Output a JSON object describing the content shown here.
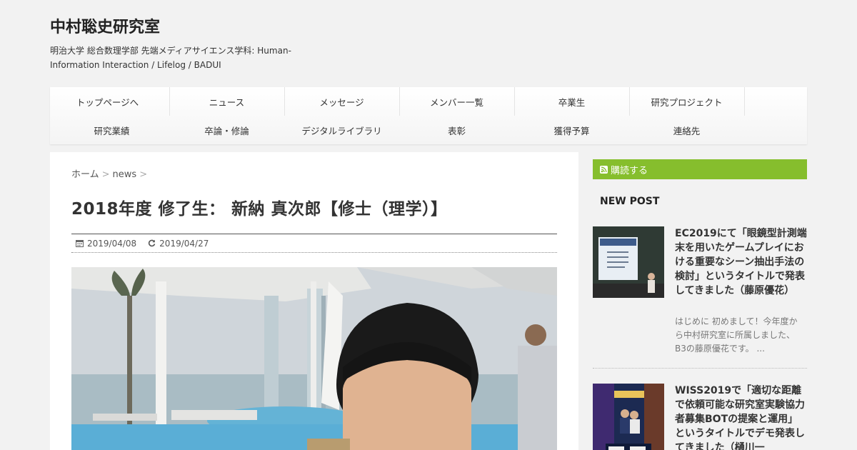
{
  "site": {
    "title": "中村聡史研究室",
    "description": "明治大学 総合数理学部 先端メディアサイエンス学科: Human-Information Interaction / Lifelog / BADUI"
  },
  "nav": {
    "row1": [
      "トップページへ",
      "ニュース",
      "メッセージ",
      "メンバー一覧",
      "卒業生",
      "研究プロジェクト"
    ],
    "row2": [
      "研究業績",
      "卒論・修論",
      "デジタルライブラリ",
      "表彰",
      "獲得予算",
      "連絡先"
    ]
  },
  "breadcrumb": {
    "home": "ホーム",
    "category": "news"
  },
  "post": {
    "title": "2018年度 修了生： 新納 真次郎【修士（理学）】",
    "published": "2019/04/08",
    "updated": "2019/04/27"
  },
  "sidebar": {
    "subscribe_label": "購読する",
    "new_post_heading": "NEW POST",
    "posts": [
      {
        "title": "EC2019にて「眼鏡型計測端末を用いたゲームプレイにおける重要なシーン抽出手法の検討」というタイトルで発表してきました（藤原優花）",
        "excerpt": "はじめに 初めまして！今年度から中村研究室に所属しました、B3の藤原優花です。 ..."
      },
      {
        "title": "WISS2019で「適切な距離で依頼可能な研究室実験協力者募集BOTの提案と運用」というタイトルでデモ発表してきました（樋川一"
      }
    ]
  },
  "colors": {
    "accent": "#86be2d",
    "background": "#f2f2f2"
  },
  "icons": {
    "published": "calendar-icon",
    "updated": "refresh-icon",
    "subscribe": "rss-icon"
  }
}
